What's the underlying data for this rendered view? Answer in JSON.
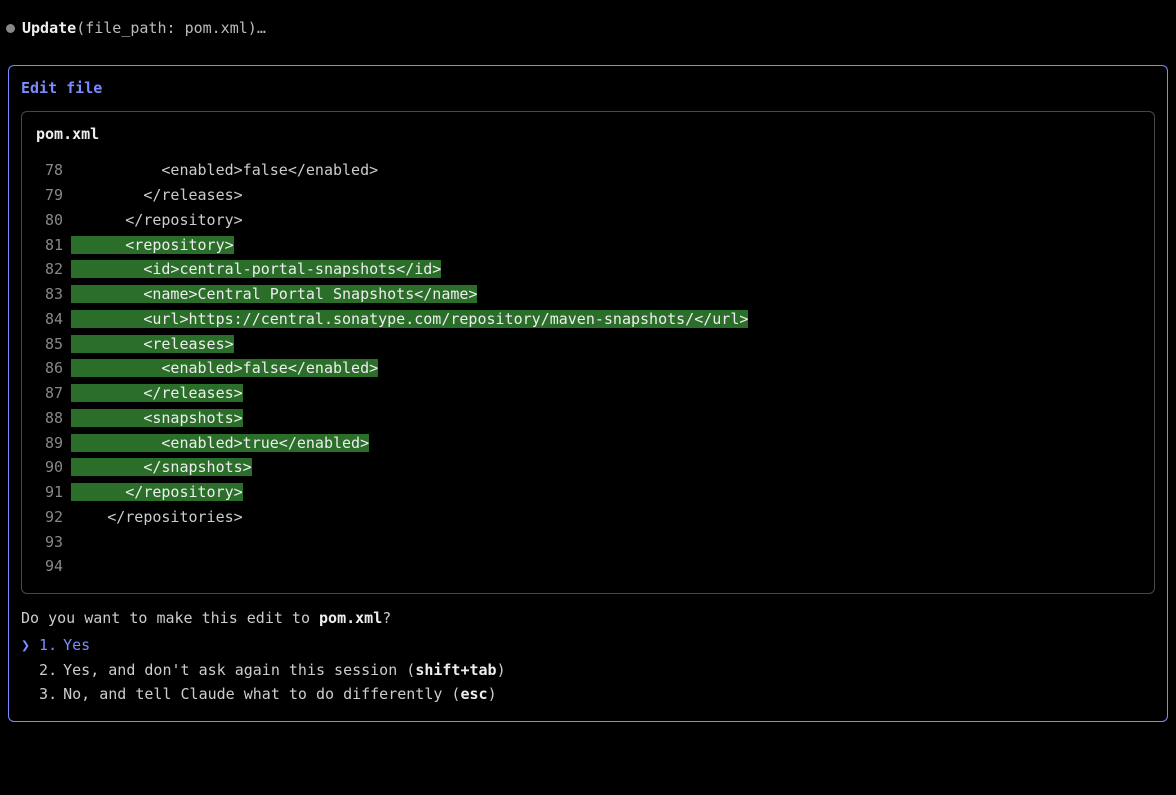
{
  "header": {
    "tool_name": "Update",
    "args_open": "(",
    "arg_label": "file_path: ",
    "arg_value": "pom.xml",
    "args_close": ")",
    "ellipsis": "…"
  },
  "panel": {
    "title": "Edit file",
    "file_name": "pom.xml",
    "lines": [
      {
        "n": "78",
        "added": false,
        "segs": [
          {
            "t": "          <enabled>false</enabled>"
          }
        ]
      },
      {
        "n": "79",
        "added": false,
        "segs": [
          {
            "t": "        </releases>"
          }
        ]
      },
      {
        "n": "80",
        "added": false,
        "segs": [
          {
            "t": "      </repository>"
          }
        ]
      },
      {
        "n": "81",
        "added": true,
        "segs": [
          {
            "t": "      <repository>",
            "hl": true
          }
        ]
      },
      {
        "n": "82",
        "added": true,
        "segs": [
          {
            "t": "        <id>central-portal-snapshots</id>",
            "hl": true
          }
        ]
      },
      {
        "n": "83",
        "added": true,
        "segs": [
          {
            "t": "        <name>Central Portal Snapshots</name>",
            "hl": true
          }
        ]
      },
      {
        "n": "84",
        "added": true,
        "segs": [
          {
            "t": "        <url>https://central.sonatype.com/repository/maven-snapshots/</url>",
            "hl": true
          }
        ]
      },
      {
        "n": "85",
        "added": true,
        "segs": [
          {
            "t": "        <releases>",
            "hl": true
          }
        ]
      },
      {
        "n": "86",
        "added": true,
        "segs": [
          {
            "t": "          <enabled>false</enabled>",
            "hl": true
          }
        ]
      },
      {
        "n": "87",
        "added": true,
        "segs": [
          {
            "t": "        </releases>",
            "hl": true
          }
        ]
      },
      {
        "n": "88",
        "added": true,
        "segs": [
          {
            "t": "        <snapshots>",
            "hl": true
          }
        ]
      },
      {
        "n": "89",
        "added": true,
        "segs": [
          {
            "t": "          <enabled>true</enabled>",
            "hl": true
          }
        ]
      },
      {
        "n": "90",
        "added": true,
        "segs": [
          {
            "t": "        </snapshots>",
            "hl": true
          }
        ]
      },
      {
        "n": "91",
        "added": true,
        "segs": [
          {
            "t": "      </repository>",
            "hl": true
          }
        ]
      },
      {
        "n": "92",
        "added": false,
        "segs": [
          {
            "t": "    </repositories>"
          }
        ]
      },
      {
        "n": "93",
        "added": false,
        "segs": [
          {
            "t": ""
          }
        ]
      },
      {
        "n": "94",
        "added": false,
        "segs": [
          {
            "t": ""
          }
        ]
      }
    ],
    "prompt": {
      "prefix": "Do you want to make this edit to ",
      "filename": "pom.xml",
      "suffix": "?"
    },
    "options": [
      {
        "n": "1.",
        "marker": "❯",
        "selected": true,
        "parts": [
          {
            "t": "Yes"
          }
        ]
      },
      {
        "n": "2.",
        "marker": "",
        "selected": false,
        "parts": [
          {
            "t": "Yes, and don't ask again this session ("
          },
          {
            "t": "shift+tab",
            "bold": true
          },
          {
            "t": ")"
          }
        ]
      },
      {
        "n": "3.",
        "marker": "",
        "selected": false,
        "parts": [
          {
            "t": "No, and tell Claude what to do differently ("
          },
          {
            "t": "esc",
            "bold": true
          },
          {
            "t": ")"
          }
        ]
      }
    ]
  }
}
